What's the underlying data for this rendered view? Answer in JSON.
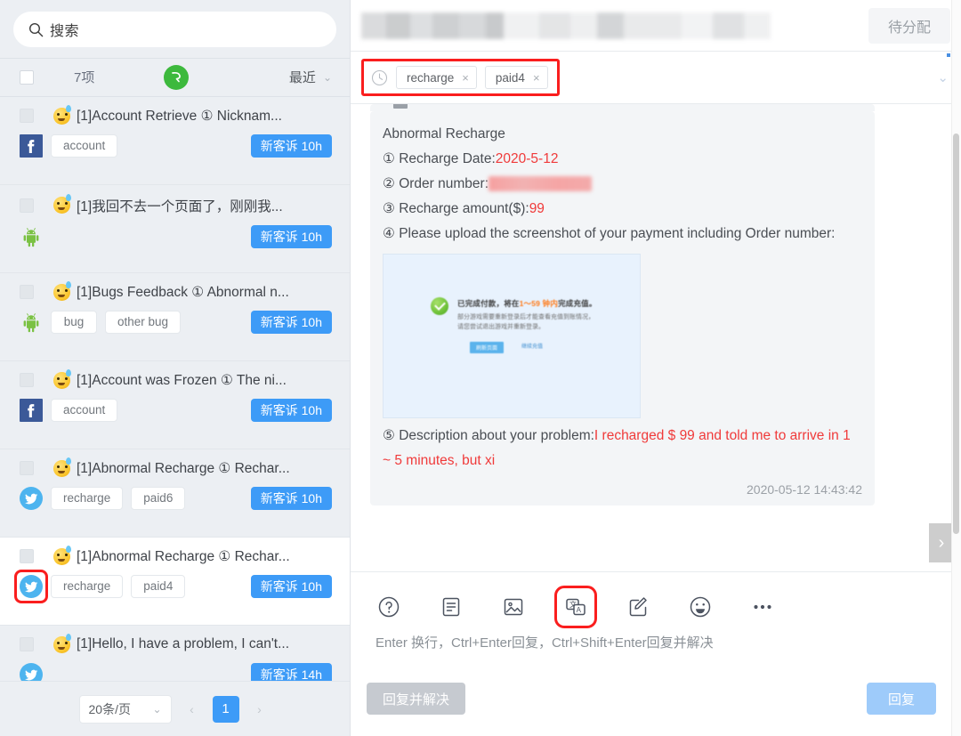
{
  "sidebar": {
    "search": {
      "placeholder": "搜索",
      "icon": "search-icon"
    },
    "toolbar": {
      "count_label": "7项",
      "badge_icon": "green-circle-icon",
      "sort_label": "最近",
      "sort_chevron": "⌄"
    },
    "tickets": [
      {
        "title": "[1]Account Retrieve ① Nicknam...",
        "platform": "facebook",
        "tags": [
          "account"
        ],
        "badge": "新客诉 10h",
        "selected": false,
        "highlighted": false
      },
      {
        "title": "[1]我回不去一个页面了，刚刚我...",
        "platform": "android",
        "tags": [],
        "badge": "新客诉 10h",
        "selected": false,
        "highlighted": false
      },
      {
        "title": "[1]Bugs Feedback ① Abnormal n...",
        "platform": "android",
        "tags": [
          "bug",
          "other bug"
        ],
        "badge": "新客诉 10h",
        "selected": false,
        "highlighted": false
      },
      {
        "title": "[1]Account was Frozen ① The ni...",
        "platform": "facebook",
        "tags": [
          "account"
        ],
        "badge": "新客诉 10h",
        "selected": false,
        "highlighted": false
      },
      {
        "title": "[1]Abnormal Recharge ① Rechar...",
        "platform": "twitter",
        "tags": [
          "recharge",
          "paid6"
        ],
        "badge": "新客诉 10h",
        "selected": false,
        "highlighted": false
      },
      {
        "title": "[1]Abnormal Recharge ① Rechar...",
        "platform": "twitter",
        "tags": [
          "recharge",
          "paid4"
        ],
        "badge": "新客诉 10h",
        "selected": true,
        "highlighted": true
      },
      {
        "title": "[1]Hello, I have a problem, I can't...",
        "platform": "twitter",
        "tags": [],
        "badge": "新客诉 14h",
        "selected": false,
        "highlighted": false
      }
    ],
    "pager": {
      "page_size": "20条/页",
      "page_size_chevron": "⌄",
      "prev": "‹",
      "current_page": "1",
      "next": "›"
    }
  },
  "conversation": {
    "header": {
      "title_redacted": "",
      "status": "待分配"
    },
    "tagbar": {
      "clock_icon": "clock-icon",
      "tags": [
        {
          "label": "recharge",
          "remove": "×"
        },
        {
          "label": "paid4",
          "remove": "×"
        }
      ],
      "expand_chevron": "⌄"
    },
    "message": {
      "heading": "Abnormal Recharge",
      "lines": [
        {
          "num": "①",
          "label": "Recharge Date:",
          "value": "2020-5-12",
          "value_style": "red"
        },
        {
          "num": "②",
          "label": "Order number:",
          "value": "1400814085799",
          "value_style": "redacted"
        },
        {
          "num": "③",
          "label": "Recharge amount($):",
          "value": "99",
          "value_style": "red"
        },
        {
          "num": "④",
          "label": "Please upload the screenshot of your payment including Order number:",
          "value": "",
          "value_style": "none"
        }
      ],
      "attachment": {
        "alt": "payment-confirmation-screenshot",
        "line1_prefix": "已完成付款，将在",
        "line1_highlight": "1～59 钟内",
        "line1_suffix": "完成充值。",
        "line2": "部分游戏需要重新登录后才能查看充值到账情况，",
        "line3": "请您尝试退出游戏并重新登录。",
        "button_primary": "刷新页面",
        "button_link": "继续充值"
      },
      "description_num": "⑤",
      "description_label": "Description about your problem:",
      "description_value": "I recharged $ 99 and told me to arrive in 1 ~ 5 minutes, but xi",
      "timestamp": "2020-05-12 14:43:42"
    },
    "composer": {
      "tools": [
        {
          "icon": "help-circle-icon",
          "name": "quick-reply-help"
        },
        {
          "icon": "document-icon",
          "name": "template-list"
        },
        {
          "icon": "image-icon",
          "name": "insert-image"
        },
        {
          "icon": "translate-icon",
          "name": "translate",
          "highlighted": true
        },
        {
          "icon": "edit-square-icon",
          "name": "edit-note"
        },
        {
          "icon": "smiley-icon",
          "name": "emoji-picker"
        },
        {
          "icon": "ellipsis-icon",
          "name": "more-options"
        }
      ],
      "hint": "Enter 换行，Ctrl+Enter回复，Ctrl+Shift+Enter回复并解决",
      "reply_resolve_label": "回复并解决",
      "reply_label": "回复"
    },
    "side_arrow": "›"
  },
  "colors": {
    "accent_blue": "#3d9bf7",
    "highlight_red": "#fa1e1e",
    "badge_green": "#3db93d",
    "text_red": "#f03a3a"
  }
}
